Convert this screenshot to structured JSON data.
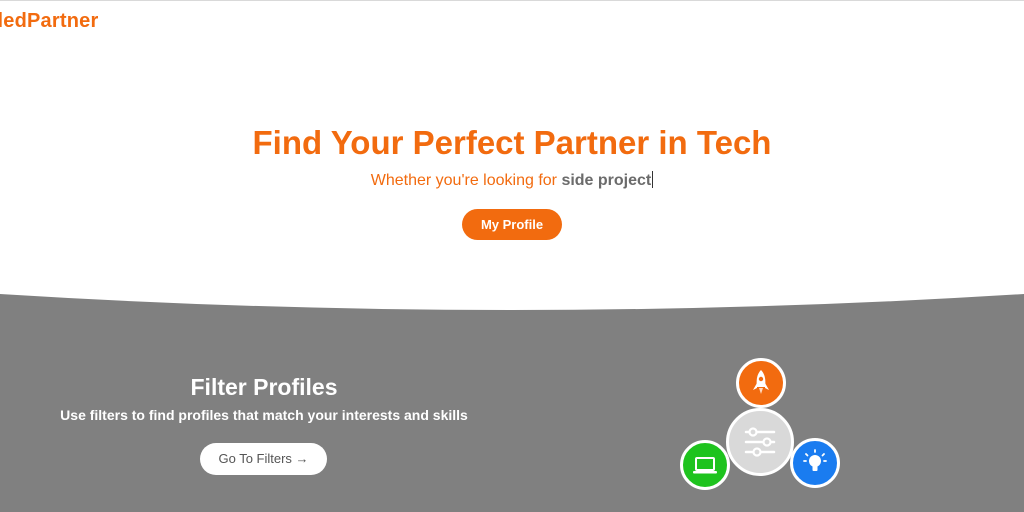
{
  "header": {
    "logo_text": "illedPartner"
  },
  "hero": {
    "title": "Find Your Perfect Partner in Tech",
    "subtitle_prefix": "Whether you're looking for ",
    "subtitle_typed": "side project",
    "profile_button_label": "My Profile"
  },
  "filter_section": {
    "title": "Filter Profiles",
    "description": "Use filters to find profiles that match your interests and skills",
    "button_label": "Go To Filters →"
  },
  "graphic": {
    "icons": [
      "rocket-icon",
      "sliders-icon",
      "laptop-icon",
      "lightbulb-icon"
    ]
  },
  "colors": {
    "brand_orange": "#f26b0f",
    "section_gray": "#808080",
    "center_gray": "#d9d9d9",
    "green": "#1ec31e",
    "blue": "#1a7cf0",
    "typed_text": "#6b6b6b"
  }
}
